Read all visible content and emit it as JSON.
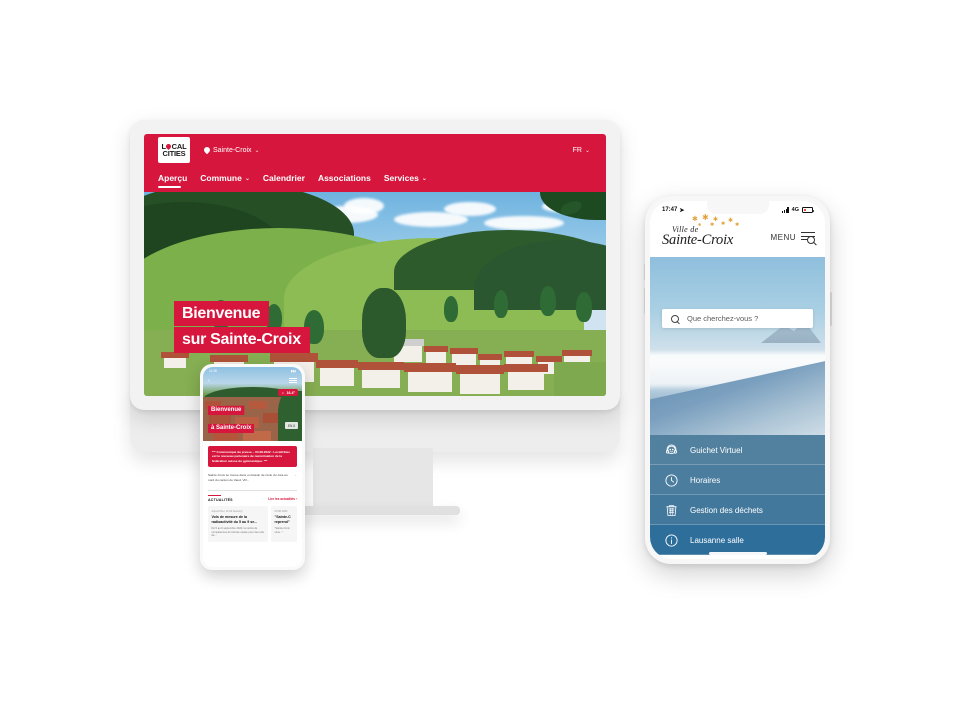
{
  "desktop": {
    "logo": {
      "line1": "L",
      "pin": "pin",
      "line1b": "CAL",
      "line2": "CITIES",
      "alt": "LOCAL CITIES"
    },
    "city_selector": {
      "label": "Sainte-Croix",
      "chevron": "⌄",
      "icon": "location-pin-icon"
    },
    "language_selector": {
      "label": "FR",
      "chevron": "⌄"
    },
    "nav": [
      {
        "label": "Aperçu",
        "active": true,
        "has_chevron": false
      },
      {
        "label": "Commune",
        "active": false,
        "has_chevron": true
      },
      {
        "label": "Calendrier",
        "active": false,
        "has_chevron": false
      },
      {
        "label": "Associations",
        "active": false,
        "has_chevron": false
      },
      {
        "label": "Services",
        "active": false,
        "has_chevron": true
      }
    ],
    "hero": {
      "line1": "Bienvenue",
      "line2": "sur Sainte-Croix"
    },
    "colors": {
      "brand_red": "#d6163c",
      "bezel": "#f2f2f2"
    }
  },
  "phone_small": {
    "status": {
      "time": "11:38",
      "right": "▮▮▮"
    },
    "hero": {
      "line1": "Bienvenue",
      "line2": "à Sainte-Croix"
    },
    "weather_badge": "16.4°",
    "camera_badge": "EN 6",
    "alert": "*** Communiqué du presse – 03.08.2022 : LocalCities est le nouveau partenaire de numérisation de la fédération suisse du gymnastique. ***",
    "intro": "Sainte-Croix se trouve dans un bassin de récle du Jura au nord du canton de Vaud. Vill...",
    "news": {
      "heading": "ACTUALITÉS",
      "link": "Lire les actualités ›"
    },
    "cards": [
      {
        "date": "Aujourd'hui, 11:00 heure(s)",
        "title": "Vols de mesure de la radioactivité du 5 au 9 se...",
        "body": "Du 5 au 9 septembre 2022, la centra de compétences de l'armée suisse pour des vols de..."
      },
      {
        "date": "03.08.2022",
        "title": "\"Sainte-C reprend\"",
        "body": "\"Sainte-Croix vous...\""
      }
    ]
  },
  "phone_large": {
    "status": {
      "time": "17:47",
      "location_icon": "location-arrow-icon",
      "network": "4G"
    },
    "logo": {
      "line1": "Ville de",
      "line2": "Sainte-Croix"
    },
    "menu": {
      "label": "MENU",
      "icon": "menu-search-icon"
    },
    "search": {
      "placeholder": "Que cherchez-vous ?",
      "icon": "search-icon"
    },
    "menu_items": [
      {
        "label": "Guichet Virtuel",
        "icon": "headset-support-icon",
        "bg": "#4a7fa3"
      },
      {
        "label": "Horaires",
        "icon": "clock-icon",
        "bg": "#437losing"
      },
      {
        "label": "Gestion des déchets",
        "icon": "trash-bin-icon",
        "bg": "#3f7aa2"
      },
      {
        "label": "Lausanne salle",
        "icon": "info-icon",
        "bg": "#2f6e9c"
      }
    ],
    "menu_item_colors": [
      "#52819f",
      "#4a7d9e",
      "#42789c",
      "#2e6e9b"
    ]
  }
}
